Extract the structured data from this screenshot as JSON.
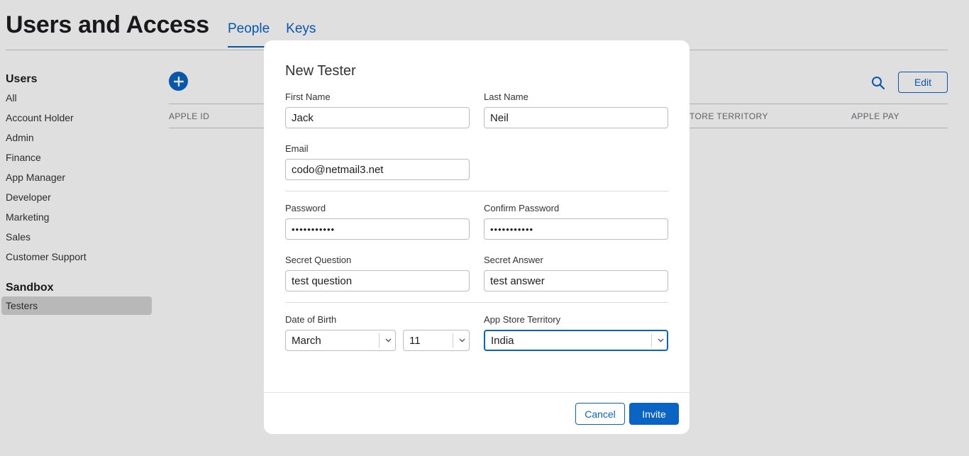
{
  "app": {
    "title": "Users and Access"
  },
  "tabs": [
    {
      "label": "People",
      "active": true
    },
    {
      "label": "Keys",
      "active": false
    }
  ],
  "sidebar": {
    "users_heading": "Users",
    "users_items": [
      "All",
      "Account Holder",
      "Admin",
      "Finance",
      "App Manager",
      "Developer",
      "Marketing",
      "Sales",
      "Customer Support"
    ],
    "sandbox_heading": "Sandbox",
    "sandbox_items": [
      "Testers"
    ],
    "selected": "Testers"
  },
  "toolbar": {
    "add_icon": "plus-circle-icon",
    "search_icon": "search-icon",
    "edit_label": "Edit"
  },
  "table": {
    "apple_id_header": "APPLE ID",
    "store_territory_header": "TORE TERRITORY",
    "apple_pay_header": "APPLE PAY"
  },
  "modal": {
    "title": "New Tester",
    "first_name": {
      "label": "First Name",
      "value": "Jack"
    },
    "last_name": {
      "label": "Last Name",
      "value": "Neil"
    },
    "email": {
      "label": "Email",
      "value": "codo@netmail3.net"
    },
    "password": {
      "label": "Password",
      "value": "•••••••••••"
    },
    "confirm_password": {
      "label": "Confirm Password",
      "value": "•••••••••••"
    },
    "secret_question": {
      "label": "Secret Question",
      "value": "test question"
    },
    "secret_answer": {
      "label": "Secret Answer",
      "value": "test answer"
    },
    "dob": {
      "label": "Date of Birth",
      "month": "March",
      "day": "11"
    },
    "territory": {
      "label": "App Store Territory",
      "value": "India"
    },
    "cancel_label": "Cancel",
    "invite_label": "Invite"
  },
  "colors": {
    "accent": "#0a64c4",
    "overlay": "#dfdfdf"
  }
}
